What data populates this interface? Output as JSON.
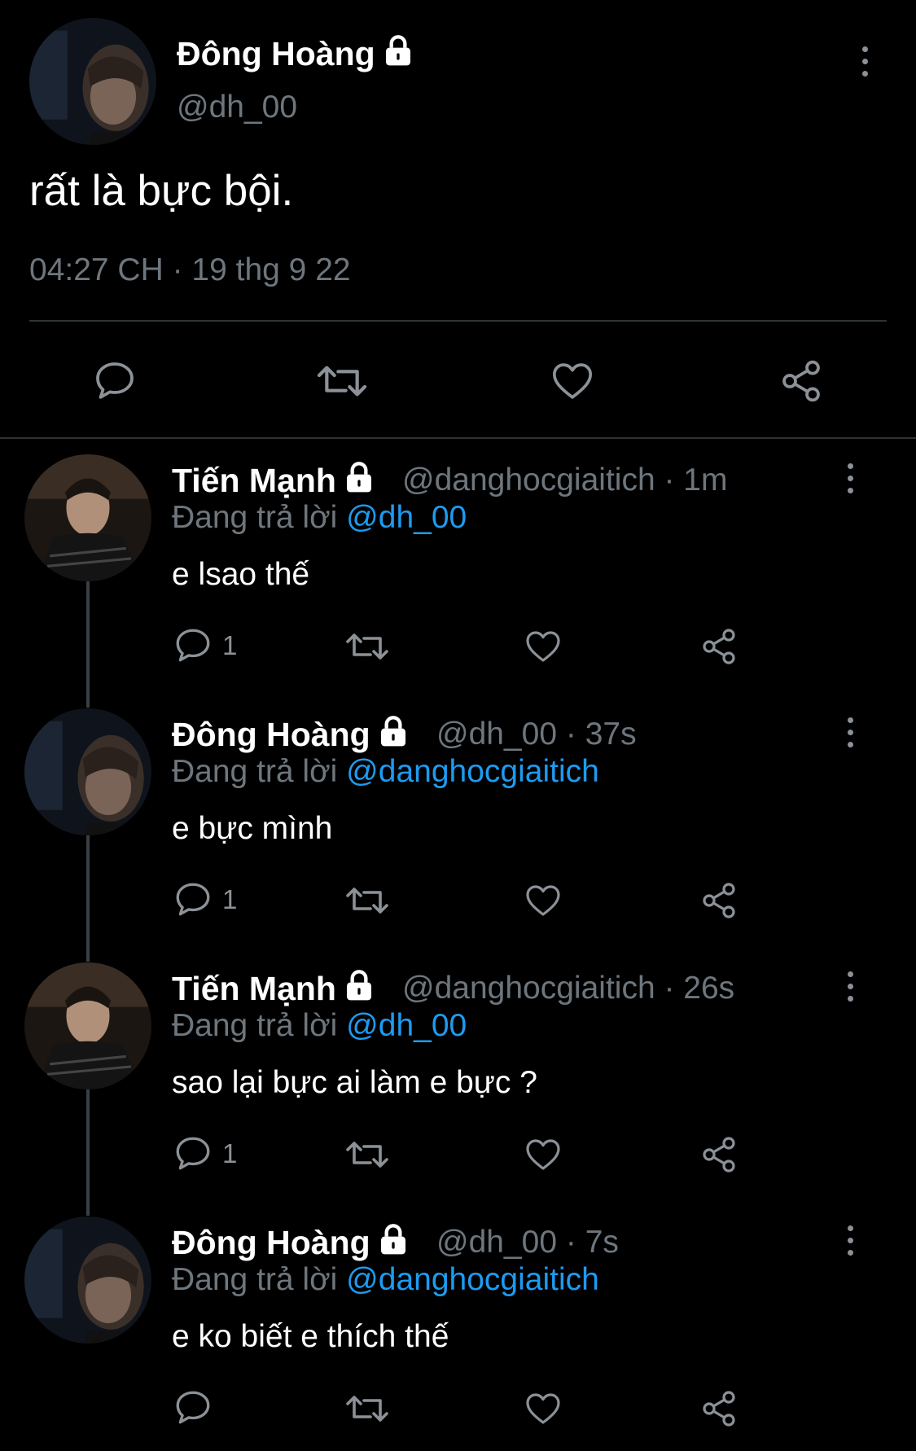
{
  "main_tweet": {
    "name": "Đông Hoàng",
    "handle": "@dh_00",
    "text": "rất là bực bội.",
    "timestamp": "04:27 CH · 19 thg 9 22"
  },
  "replies": [
    {
      "name": "Tiến Mạnh",
      "meta": "@danghocgiaitich · 1m",
      "replying_prefix": "Đang trả lời",
      "replying_to": "@dh_00",
      "text": "e lsao thế",
      "reply_count": "1"
    },
    {
      "name": "Đông Hoàng",
      "meta": "@dh_00 · 37s",
      "replying_prefix": "Đang trả lời",
      "replying_to": "@danghocgiaitich",
      "text": "e bực mình",
      "reply_count": "1"
    },
    {
      "name": "Tiến Mạnh",
      "meta": "@danghocgiaitich · 26s",
      "replying_prefix": "Đang trả lời",
      "replying_to": "@dh_00",
      "text": "sao lại bực ai làm e bực ?",
      "reply_count": "1"
    },
    {
      "name": "Đông Hoàng",
      "meta": "@dh_00 · 7s",
      "replying_prefix": "Đang trả lời",
      "replying_to": "@danghocgiaitich",
      "text": "e ko biết e thích thế",
      "reply_count": ""
    }
  ],
  "colors": {
    "background": "#000000",
    "secondary_text": "#6e767d",
    "link": "#1d9bf0",
    "divider": "#2f3336"
  }
}
